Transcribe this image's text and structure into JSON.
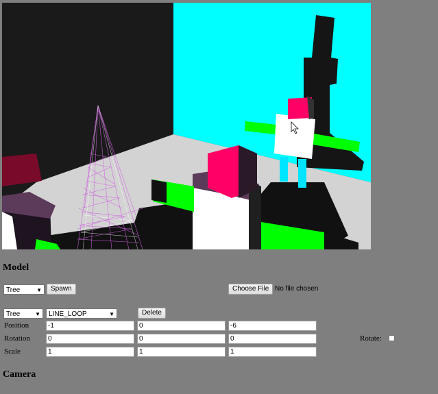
{
  "model": {
    "heading": "Model",
    "type_select": "Tree",
    "spawn_label": "Spawn",
    "choose_file_label": "Choose File",
    "no_file_text": "No file chosen",
    "instance_select": "Tree",
    "mode_select": "LINE_LOOP",
    "delete_label": "Delete",
    "position_label": "Position",
    "rotation_label": "Rotation",
    "scale_label": "Scale",
    "position": [
      "-1",
      "0",
      "-6"
    ],
    "rotation": [
      "0",
      "0",
      "0"
    ],
    "scale": [
      "1",
      "1",
      "1"
    ],
    "rotate_label": "Rotate:"
  },
  "camera": {
    "heading": "Camera"
  },
  "icons": {
    "select_arrow": "▼"
  },
  "colors": {
    "background": "#7f7f80",
    "sky": "#00ffff",
    "floor": "#d3d3d3",
    "magenta": "#ff0066",
    "green": "#00ff00",
    "purple": "#5c3a5a",
    "wireframe": "#d060e0"
  }
}
